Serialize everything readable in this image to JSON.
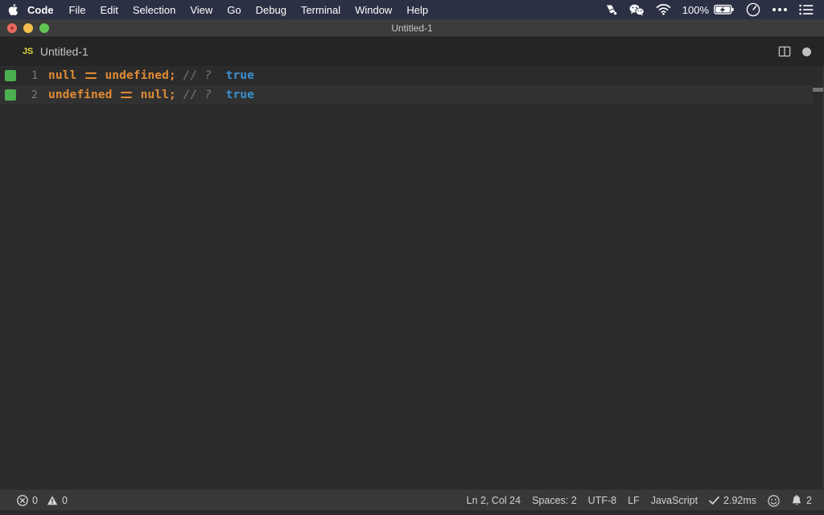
{
  "menubar": {
    "apple_icon": "apple-logo-icon",
    "items": [
      {
        "label": "Code",
        "bold": true
      },
      {
        "label": "File",
        "bold": false
      },
      {
        "label": "Edit",
        "bold": false
      },
      {
        "label": "Selection",
        "bold": false
      },
      {
        "label": "View",
        "bold": false
      },
      {
        "label": "Go",
        "bold": false
      },
      {
        "label": "Debug",
        "bold": false
      },
      {
        "label": "Terminal",
        "bold": false
      },
      {
        "label": "Window",
        "bold": false
      },
      {
        "label": "Help",
        "bold": false
      }
    ],
    "right": {
      "dropbox_icon": "dropbox-icon",
      "wechat_icon": "wechat-icon",
      "wifi_icon": "wifi-icon",
      "battery_percent": "100%",
      "battery_icon": "battery-charging-icon",
      "siri_icon": "siri-icon",
      "controlcenter_icon": "ellipsis-icon",
      "notifications_icon": "list-icon"
    },
    "background": "#2b3044"
  },
  "window": {
    "title": "Untitled-1",
    "traffic_lights": [
      "close",
      "minimize",
      "maximize"
    ]
  },
  "tab": {
    "file_type_badge": "JS",
    "label": "Untitled-1",
    "split_editor_icon": "split-editor-icon",
    "unsaved_dot": "unsaved-indicator-dot"
  },
  "editor": {
    "background": "#2b2b2b",
    "language": "JavaScript",
    "lines": [
      {
        "number": "1",
        "gutter_marker": true,
        "keyword1": "null",
        "operator": "==",
        "keyword2": "undefined;",
        "comment": "// ?",
        "value": "true",
        "current": false
      },
      {
        "number": "2",
        "gutter_marker": true,
        "keyword1": "undefined",
        "operator": "==",
        "keyword2": "null;",
        "comment": "// ?",
        "value": "true",
        "current": true
      }
    ],
    "colors": {
      "keyword": "#e08b35",
      "comment": "#777777",
      "value": "#3a92d2",
      "gutter_marker": "#4caf50",
      "line_number": "#7a7a7a"
    }
  },
  "statusbar": {
    "errors_icon": "error-circle-icon",
    "errors_count": "0",
    "warnings_icon": "warning-triangle-icon",
    "warnings_count": "0",
    "cursor_position": "Ln 2, Col 24",
    "indentation": "Spaces: 2",
    "encoding": "UTF-8",
    "line_ending": "LF",
    "language_mode": "JavaScript",
    "run_time": "2.92ms",
    "run_time_icon": "checkmark-icon",
    "feedback_icon": "smiley-icon",
    "bell_icon": "bell-icon",
    "notification_count": "2",
    "background": "#383838"
  }
}
